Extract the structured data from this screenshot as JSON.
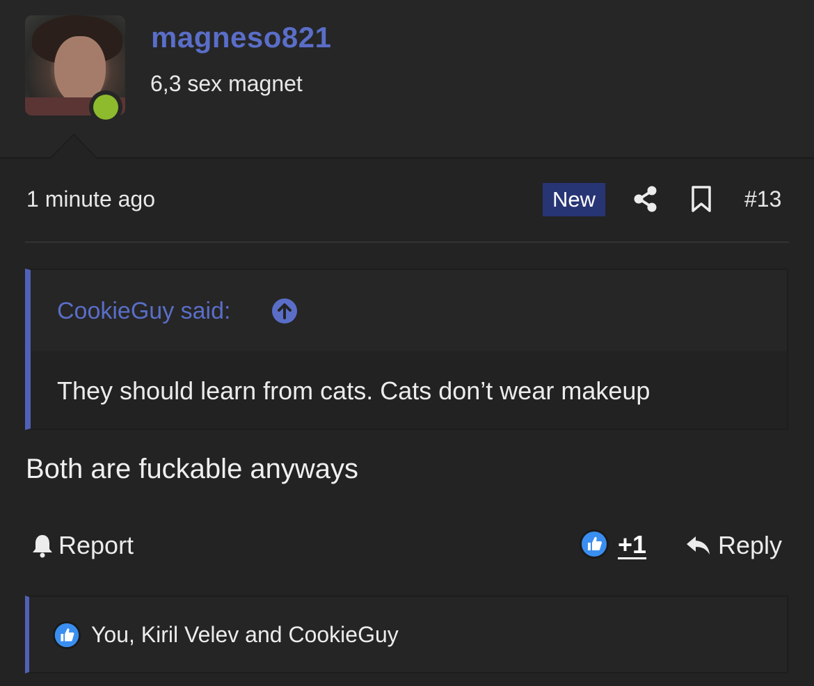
{
  "author": {
    "username": "magneso821",
    "user_title": "6,3 sex magnet",
    "status": "online",
    "status_color": "#8dbb2d"
  },
  "post": {
    "time": "1 minute ago",
    "new_badge": "New",
    "number": "#13",
    "body": "Both are fuckable anyways"
  },
  "quote": {
    "author_label": "CookieGuy said:",
    "text": "They should learn from cats. Cats don’t wear makeup"
  },
  "actions": {
    "report_label": "Report",
    "reaction_count": "+1",
    "reply_label": "Reply"
  },
  "reactions": {
    "summary": "You, Kiril Velev and CookieGuy"
  },
  "icons": [
    "share-icon",
    "bookmark-icon",
    "arrow-up-circle-icon",
    "bell-icon",
    "like-icon",
    "reply-arrow-icon"
  ],
  "colors": {
    "accent": "#5a6ec8",
    "quote_bar": "#5161b7",
    "badge_bg": "#283575",
    "background": "#232323"
  }
}
